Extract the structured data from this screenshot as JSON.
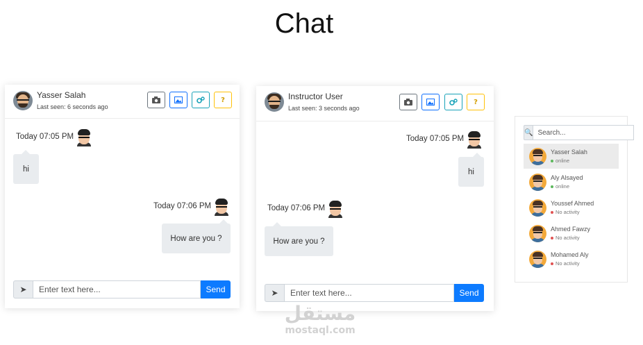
{
  "page": {
    "title": "Chat"
  },
  "colors": {
    "primary": "#0d7bff",
    "online": "#5cb85c",
    "no_activity": "#e05252",
    "bubble": "#e9ecef",
    "active_row": "#ebebeb"
  },
  "chat1": {
    "user_name": "Yasser Salah",
    "last_seen": "Last seen: 6 seconds ago",
    "header_buttons": [
      {
        "icon": "camera-icon",
        "label": ""
      },
      {
        "icon": "image-icon",
        "label": ""
      },
      {
        "icon": "gears-icon",
        "label": ""
      },
      {
        "icon": "question-icon",
        "label": "?"
      }
    ],
    "messages": [
      {
        "side": "left",
        "time": "Today 07:05 PM",
        "text": "hi"
      },
      {
        "side": "right",
        "time": "Today 07:06 PM",
        "text": "How are you ?"
      }
    ],
    "input_placeholder": "Enter text here...",
    "send_label": "Send"
  },
  "chat2": {
    "user_name": "Instructor User",
    "last_seen": "Last seen: 3 seconds ago",
    "messages": [
      {
        "side": "right",
        "time": "Today 07:05 PM",
        "text": "hi"
      },
      {
        "side": "left",
        "time": "Today 07:06 PM",
        "text": "How are you ?"
      }
    ],
    "input_placeholder": "Enter text here...",
    "send_label": "Send"
  },
  "user_list": {
    "search_placeholder": "Search...",
    "users": [
      {
        "name": "Yasser Salah",
        "status": "online",
        "active": true
      },
      {
        "name": "Aly Alsayed",
        "status": "online",
        "active": false
      },
      {
        "name": "Youssef Ahmed",
        "status": "No activity",
        "active": false
      },
      {
        "name": "Ahmed Fawzy",
        "status": "No activity",
        "active": false
      },
      {
        "name": "Mohamed Aly",
        "status": "No activity",
        "active": false
      }
    ]
  },
  "watermark": {
    "arabic": "مستقل",
    "latin": "mostaql.com"
  }
}
